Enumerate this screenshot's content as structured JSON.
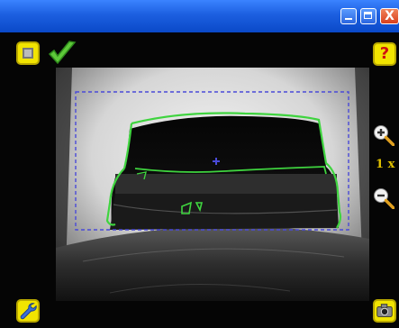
{
  "window": {
    "controls": {
      "minimize": "minimize-icon",
      "maximize": "maximize-icon",
      "close_label": "X"
    }
  },
  "toolbar": {
    "help_label": "?",
    "zoom_level": "1 x"
  },
  "status": {
    "inspection": "pass",
    "status_color": "#5ec93a"
  },
  "colors": {
    "accent": "#f2e400",
    "titlebar": "#1c5fe0",
    "contour": "#3fd43f",
    "roi": "#4a4ad8"
  }
}
